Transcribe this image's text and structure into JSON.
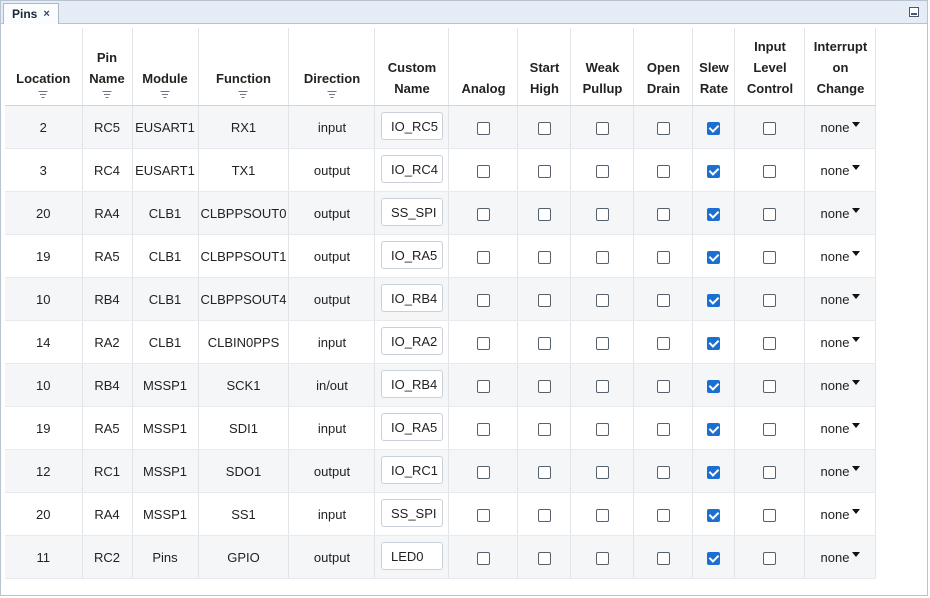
{
  "tab": {
    "title": "Pins",
    "close_glyph": "×"
  },
  "columns": [
    {
      "key": "location",
      "label": "Location",
      "filter": true
    },
    {
      "key": "pin",
      "label": "Pin Name",
      "filter": true
    },
    {
      "key": "module",
      "label": "Module",
      "filter": true
    },
    {
      "key": "function",
      "label": "Function",
      "filter": true
    },
    {
      "key": "direction",
      "label": "Direction",
      "filter": true
    },
    {
      "key": "custom",
      "label": "Custom Name",
      "filter": false
    },
    {
      "key": "analog",
      "label": "Analog",
      "filter": false
    },
    {
      "key": "start_high",
      "label": "Start High",
      "filter": false
    },
    {
      "key": "weak_pullup",
      "label": "Weak Pullup",
      "filter": false
    },
    {
      "key": "open_drain",
      "label": "Open Drain",
      "filter": false
    },
    {
      "key": "slew_rate",
      "label": "Slew Rate",
      "filter": false
    },
    {
      "key": "input_level",
      "label": "Input Level Control",
      "filter": false
    },
    {
      "key": "ioc",
      "label": "Interrupt on Change",
      "filter": false
    }
  ],
  "rows": [
    {
      "location": "2",
      "pin": "RC5",
      "module": "EUSART1",
      "function": "RX1",
      "direction": "input",
      "custom": "IO_RC5",
      "analog": false,
      "start_high": false,
      "weak_pullup": false,
      "open_drain": false,
      "slew_rate": true,
      "input_level": false,
      "ioc": "none"
    },
    {
      "location": "3",
      "pin": "RC4",
      "module": "EUSART1",
      "function": "TX1",
      "direction": "output",
      "custom": "IO_RC4",
      "analog": false,
      "start_high": false,
      "weak_pullup": false,
      "open_drain": false,
      "slew_rate": true,
      "input_level": false,
      "ioc": "none"
    },
    {
      "location": "20",
      "pin": "RA4",
      "module": "CLB1",
      "function": "CLBPPSOUT0",
      "direction": "output",
      "custom": "SS_SPI",
      "analog": false,
      "start_high": false,
      "weak_pullup": false,
      "open_drain": false,
      "slew_rate": true,
      "input_level": false,
      "ioc": "none"
    },
    {
      "location": "19",
      "pin": "RA5",
      "module": "CLB1",
      "function": "CLBPPSOUT1",
      "direction": "output",
      "custom": "IO_RA5",
      "analog": false,
      "start_high": false,
      "weak_pullup": false,
      "open_drain": false,
      "slew_rate": true,
      "input_level": false,
      "ioc": "none"
    },
    {
      "location": "10",
      "pin": "RB4",
      "module": "CLB1",
      "function": "CLBPPSOUT4",
      "direction": "output",
      "custom": "IO_RB4",
      "analog": false,
      "start_high": false,
      "weak_pullup": false,
      "open_drain": false,
      "slew_rate": true,
      "input_level": false,
      "ioc": "none"
    },
    {
      "location": "14",
      "pin": "RA2",
      "module": "CLB1",
      "function": "CLBIN0PPS",
      "direction": "input",
      "custom": "IO_RA2",
      "analog": false,
      "start_high": false,
      "weak_pullup": false,
      "open_drain": false,
      "slew_rate": true,
      "input_level": false,
      "ioc": "none"
    },
    {
      "location": "10",
      "pin": "RB4",
      "module": "MSSP1",
      "function": "SCK1",
      "direction": "in/out",
      "custom": "IO_RB4",
      "analog": false,
      "start_high": false,
      "weak_pullup": false,
      "open_drain": false,
      "slew_rate": true,
      "input_level": false,
      "ioc": "none"
    },
    {
      "location": "19",
      "pin": "RA5",
      "module": "MSSP1",
      "function": "SDI1",
      "direction": "input",
      "custom": "IO_RA5",
      "analog": false,
      "start_high": false,
      "weak_pullup": false,
      "open_drain": false,
      "slew_rate": true,
      "input_level": false,
      "ioc": "none"
    },
    {
      "location": "12",
      "pin": "RC1",
      "module": "MSSP1",
      "function": "SDO1",
      "direction": "output",
      "custom": "IO_RC1",
      "analog": false,
      "start_high": false,
      "weak_pullup": false,
      "open_drain": false,
      "slew_rate": true,
      "input_level": false,
      "ioc": "none"
    },
    {
      "location": "20",
      "pin": "RA4",
      "module": "MSSP1",
      "function": "SS1",
      "direction": "input",
      "custom": "SS_SPI",
      "analog": false,
      "start_high": false,
      "weak_pullup": false,
      "open_drain": false,
      "slew_rate": true,
      "input_level": false,
      "ioc": "none"
    },
    {
      "location": "11",
      "pin": "RC2",
      "module": "Pins",
      "function": "GPIO",
      "direction": "output",
      "custom": "LED0",
      "analog": false,
      "start_high": false,
      "weak_pullup": false,
      "open_drain": false,
      "slew_rate": true,
      "input_level": false,
      "ioc": "none"
    }
  ],
  "colors": {
    "accent": "#1a6fd1",
    "row_alt": "#f5f6f8",
    "tabbar": "#e6ecf5"
  },
  "icons": {
    "close": "close-icon",
    "minimize": "minimize-icon",
    "filter": "filter-icon",
    "dropdown": "chevron-down-icon"
  }
}
